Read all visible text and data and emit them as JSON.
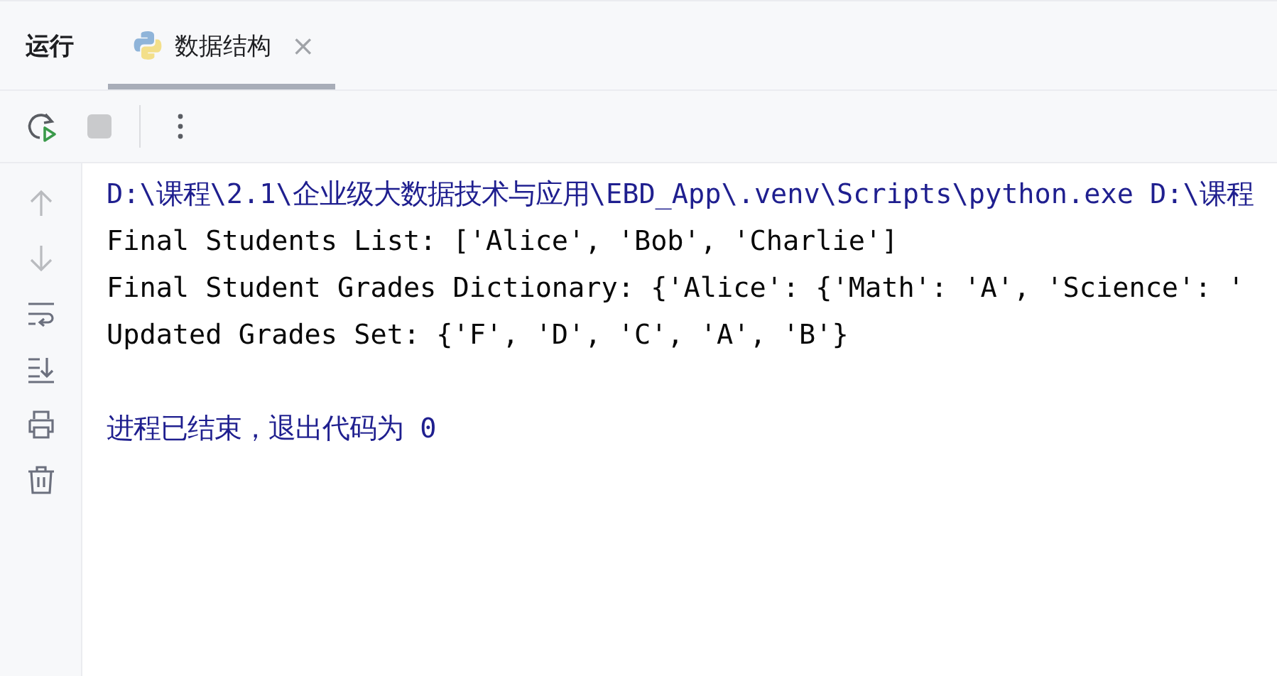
{
  "panel_title": "运行",
  "tabs": [
    {
      "label": "数据结构",
      "selected": true,
      "close": "×"
    }
  ],
  "toolbar": [
    {
      "kind": "rerun",
      "disabled": false
    },
    {
      "kind": "stop",
      "disabled": true
    },
    {
      "kind": "more"
    }
  ],
  "gutter": [
    {
      "kind": "up",
      "disabled": true
    },
    {
      "kind": "down",
      "disabled": true
    },
    {
      "kind": "wrap",
      "disabled": false
    },
    {
      "kind": "scroll-end",
      "disabled": false
    },
    {
      "kind": "print",
      "disabled": false
    },
    {
      "kind": "trash",
      "disabled": false
    }
  ],
  "console": [
    {
      "kind": "command",
      "text": "D:\\课程\\2.1\\企业级大数据技术与应用\\EBD_App\\.venv\\Scripts\\python.exe D:\\课程"
    },
    {
      "kind": "output",
      "text": "Final Students List: ['Alice', 'Bob', 'Charlie']"
    },
    {
      "kind": "output",
      "text": "Final Student Grades Dictionary: {'Alice': {'Math': 'A', 'Science': '"
    },
    {
      "kind": "output",
      "text": "Updated Grades Set: {'F', 'D', 'C', 'A', 'B'}"
    },
    {
      "kind": "exit",
      "text": "进程已结束，退出代码为 0"
    }
  ]
}
